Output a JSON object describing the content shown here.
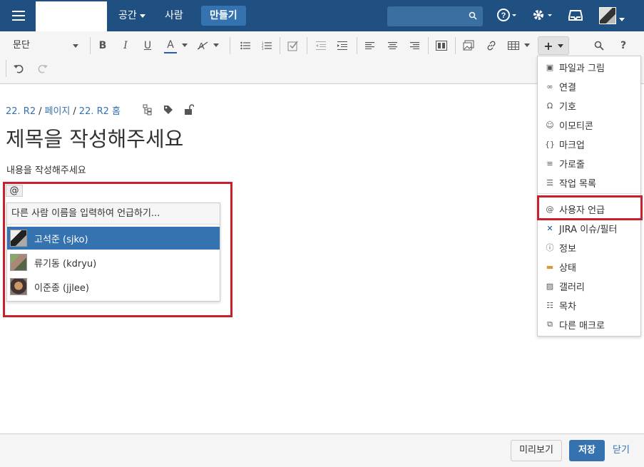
{
  "nav": {
    "space": "공간",
    "people": "사람",
    "create": "만들기",
    "search_placeholder": ""
  },
  "toolbar": {
    "paragraph": "문단",
    "bold": "B",
    "italic": "I",
    "underline": "U",
    "textcolor": "A",
    "plus": "+",
    "help": "?"
  },
  "insert_menu": {
    "items": [
      {
        "label": "파일과 그림",
        "icon": "image-file-icon"
      },
      {
        "label": "연결",
        "icon": "link-icon"
      },
      {
        "label": "기호",
        "icon": "omega-icon"
      },
      {
        "label": "이모티콘",
        "icon": "smiley-icon"
      },
      {
        "label": "마크업",
        "icon": "braces-icon"
      },
      {
        "label": "가로줄",
        "icon": "horizontal-rule-icon"
      },
      {
        "label": "작업 목록",
        "icon": "task-list-icon"
      },
      {
        "label": "사용자 언급",
        "icon": "at-icon"
      },
      {
        "label": "JIRA 이슈/필터",
        "icon": "jira-icon"
      },
      {
        "label": "정보",
        "icon": "info-icon"
      },
      {
        "label": "상태",
        "icon": "status-icon"
      },
      {
        "label": "갤러리",
        "icon": "gallery-icon"
      },
      {
        "label": "목차",
        "icon": "toc-icon"
      },
      {
        "label": "다른 매크로",
        "icon": "macro-icon"
      }
    ]
  },
  "breadcrumb": [
    "22. R2",
    "페이지",
    "22. R2 홈"
  ],
  "page": {
    "title": "제목을 작성해주세요",
    "content": "내용을 작성해주세요",
    "at_symbol": "@"
  },
  "mention": {
    "hint": "다른 사람 이름을 입력하여 언급하기...",
    "users": [
      {
        "name": "고석준 (sjko)"
      },
      {
        "name": "류기동 (kdryu)"
      },
      {
        "name": "이준종 (jjlee)"
      }
    ]
  },
  "footer": {
    "preview": "미리보기",
    "save": "저장",
    "close": "닫기"
  },
  "colors": {
    "topbar": "#205081",
    "accent": "#3572b0",
    "highlight": "#c8202d"
  }
}
